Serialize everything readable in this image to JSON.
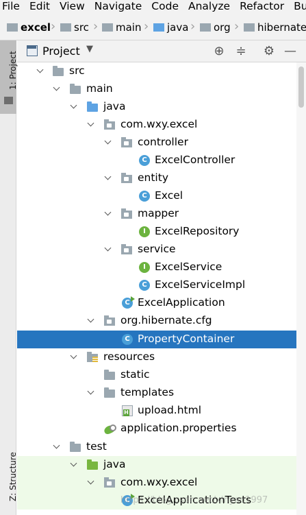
{
  "menu": [
    "File",
    "Edit",
    "View",
    "Navigate",
    "Code",
    "Analyze",
    "Refactor",
    "Bu"
  ],
  "breadcrumbs": [
    "excel",
    "src",
    "main",
    "java",
    "org",
    "hibernate"
  ],
  "side_tabs": {
    "project": "1: Project",
    "structure": "Z: Structure"
  },
  "panel": {
    "title": "Project"
  },
  "tree": [
    {
      "label": "src",
      "icon": "folder-icon"
    },
    {
      "label": "main",
      "icon": "folder-icon"
    },
    {
      "label": "java",
      "icon": "source-folder-icon"
    },
    {
      "label": "com.wxy.excel",
      "icon": "package-icon"
    },
    {
      "label": "controller",
      "icon": "package-icon"
    },
    {
      "label": "ExcelController",
      "icon": "class-icon",
      "badge": "C"
    },
    {
      "label": "entity",
      "icon": "package-icon"
    },
    {
      "label": "Excel",
      "icon": "class-icon",
      "badge": "C"
    },
    {
      "label": "mapper",
      "icon": "package-icon"
    },
    {
      "label": "ExcelRepository",
      "icon": "interface-icon",
      "badge": "I"
    },
    {
      "label": "service",
      "icon": "package-icon"
    },
    {
      "label": "ExcelService",
      "icon": "interface-icon",
      "badge": "I"
    },
    {
      "label": "ExcelServiceImpl",
      "icon": "class-icon",
      "badge": "C"
    },
    {
      "label": "ExcelApplication",
      "icon": "spring-app-icon",
      "badge": "C"
    },
    {
      "label": "org.hibernate.cfg",
      "icon": "package-icon"
    },
    {
      "label": "PropertyContainer",
      "icon": "class-icon",
      "badge": "C",
      "selected": true
    },
    {
      "label": "resources",
      "icon": "resources-folder-icon"
    },
    {
      "label": "static",
      "icon": "folder-icon"
    },
    {
      "label": "templates",
      "icon": "folder-icon"
    },
    {
      "label": "upload.html",
      "icon": "html-file-icon"
    },
    {
      "label": "application.properties",
      "icon": "properties-file-icon"
    },
    {
      "label": "test",
      "icon": "folder-icon"
    },
    {
      "label": "java",
      "icon": "test-source-folder-icon"
    },
    {
      "label": "com.wxy.excel",
      "icon": "package-icon"
    },
    {
      "label": "ExcelApplicationTests",
      "icon": "test-class-icon",
      "badge": "C"
    }
  ],
  "watermark": "https://blog.csdn.net/xinyao1997",
  "colors": {
    "selection": "#2675bf",
    "test_row": "#eefae8",
    "class_icon": "#4a9fd8",
    "interface_icon": "#6cb33f"
  }
}
